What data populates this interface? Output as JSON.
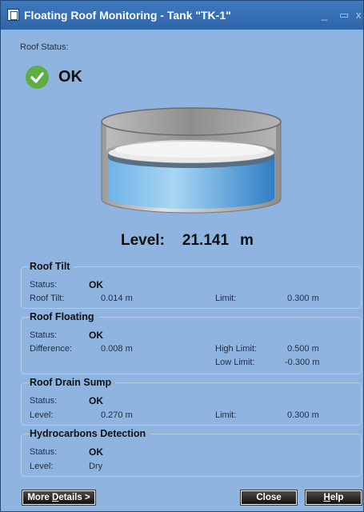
{
  "titlebar": {
    "title": "Floating Roof Monitoring - Tank \"TK-1\"",
    "minimize": "_",
    "maximize": "▭",
    "close": "x"
  },
  "roof_status": {
    "label": "Roof Status:",
    "value": "OK"
  },
  "level": {
    "label": "Level:",
    "value": "21.141",
    "unit": "m"
  },
  "groups": {
    "roof_tilt": {
      "title": "Roof Tilt",
      "status_label": "Status:",
      "status_value": "OK",
      "tilt_label": "Roof Tilt:",
      "tilt_value": "0.014 m",
      "limit_label": "Limit:",
      "limit_value": "0.300 m"
    },
    "roof_floating": {
      "title": "Roof Floating",
      "status_label": "Status:",
      "status_value": "OK",
      "diff_label": "Difference:",
      "diff_value": "0.008 m",
      "high_label": "High Limit:",
      "high_value": "0.500 m",
      "low_label": "Low Limit:",
      "low_value": "-0.300 m"
    },
    "roof_drain": {
      "title": "Roof Drain Sump",
      "status_label": "Status:",
      "status_value": "OK",
      "level_label": "Level:",
      "level_value": "0.270 m",
      "limit_label": "Limit:",
      "limit_value": "0.300 m"
    },
    "hydrocarbons": {
      "title": "Hydrocarbons Detection",
      "status_label": "Status:",
      "status_value": "OK",
      "level_label": "Level:",
      "level_value": "Dry"
    }
  },
  "buttons": {
    "more_prefix": "More ",
    "more_u": "D",
    "more_suffix": "etails >",
    "close": "Close",
    "help_u": "H",
    "help_suffix": "elp"
  },
  "colors": {
    "ok_green": "#5fae45",
    "panel": "#8fb4df",
    "titlebar": "#2f65a8"
  }
}
